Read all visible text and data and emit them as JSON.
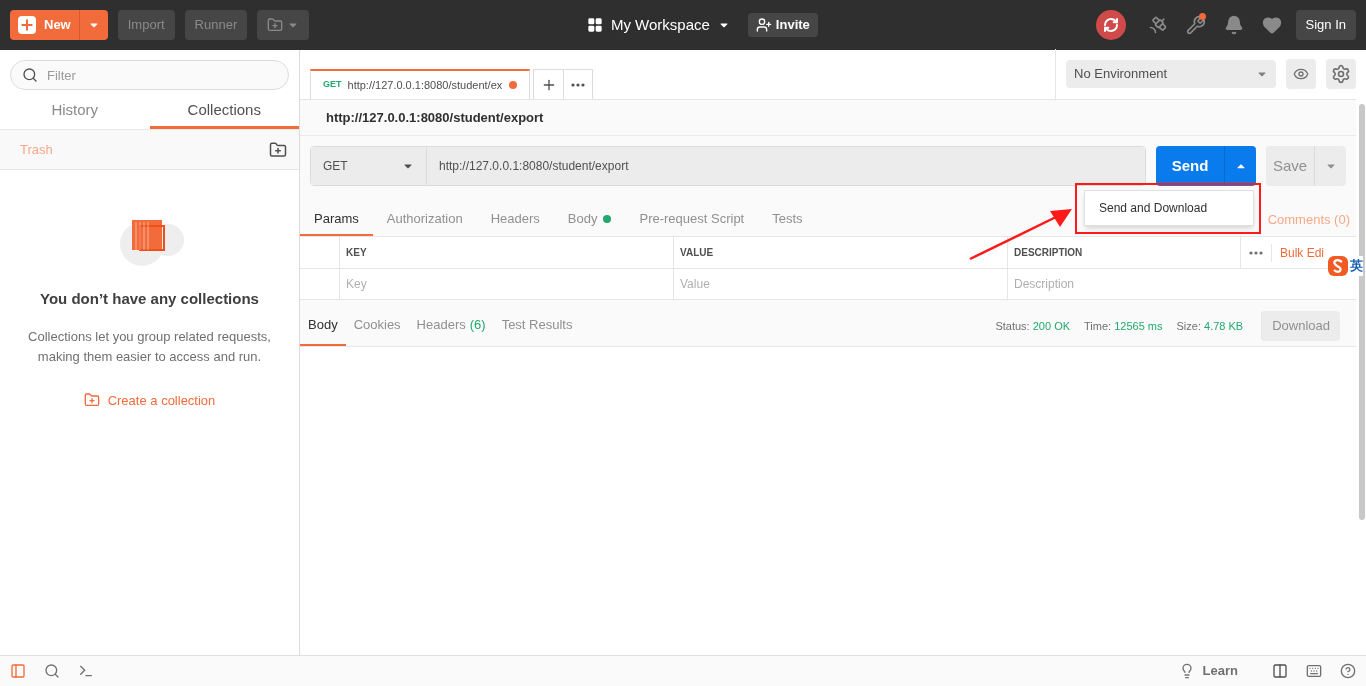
{
  "header": {
    "new_button": "New",
    "import_button": "Import",
    "runner_button": "Runner",
    "workspace": "My Workspace",
    "invite_button": "Invite",
    "sign_in_button": "Sign In",
    "has_notification": true
  },
  "sidebar": {
    "filter_placeholder": "Filter",
    "tabs": [
      {
        "label": "History",
        "selected": false
      },
      {
        "label": "Collections",
        "selected": true
      }
    ],
    "trash": "Trash",
    "empty_title": "You don’t have any collections",
    "empty_text": "Collections let you group related requests, making them easier to access and run.",
    "create_link": "Create a collection"
  },
  "request_tabs": [
    {
      "method": "GET",
      "url": "http://127.0.0.1:8080/student/ex",
      "unsaved": true,
      "selected": true
    }
  ],
  "environment": {
    "value": "No Environment"
  },
  "request": {
    "title": "http://127.0.0.1:8080/student/export",
    "method": "GET",
    "url": "http://127.0.0.1:8080/student/export",
    "send_button": "Send",
    "save_button": "Save"
  },
  "send_menu": {
    "items": [
      "Send and Download"
    ]
  },
  "request_sections": [
    {
      "label": "Params",
      "selected": true,
      "dot": false
    },
    {
      "label": "Authorization",
      "selected": false,
      "dot": false
    },
    {
      "label": "Headers",
      "selected": false,
      "dot": false
    },
    {
      "label": "Body",
      "selected": false,
      "dot": true
    },
    {
      "label": "Pre-request Script",
      "selected": false,
      "dot": false
    },
    {
      "label": "Tests",
      "selected": false,
      "dot": false
    }
  ],
  "comments": "Comments (0)",
  "params_table": {
    "columns": [
      "KEY",
      "VALUE",
      "DESCRIPTION"
    ],
    "bulk_edit": "Bulk Edi",
    "placeholders": [
      "Key",
      "Value",
      "Description"
    ]
  },
  "ime_badge": {
    "label": "英"
  },
  "response": {
    "tabs": [
      {
        "label": "Body",
        "selected": true
      },
      {
        "label": "Cookies",
        "selected": false
      },
      {
        "label": "Headers",
        "count": "(6)",
        "selected": false
      },
      {
        "label": "Test Results",
        "selected": false
      }
    ],
    "stats": [
      {
        "label": "Status:",
        "value": "200 OK"
      },
      {
        "label": "Time:",
        "value": "12565 ms"
      },
      {
        "label": "Size:",
        "value": "4.78 KB"
      }
    ],
    "download_button": "Download"
  },
  "footer": {
    "learn": "Learn"
  }
}
